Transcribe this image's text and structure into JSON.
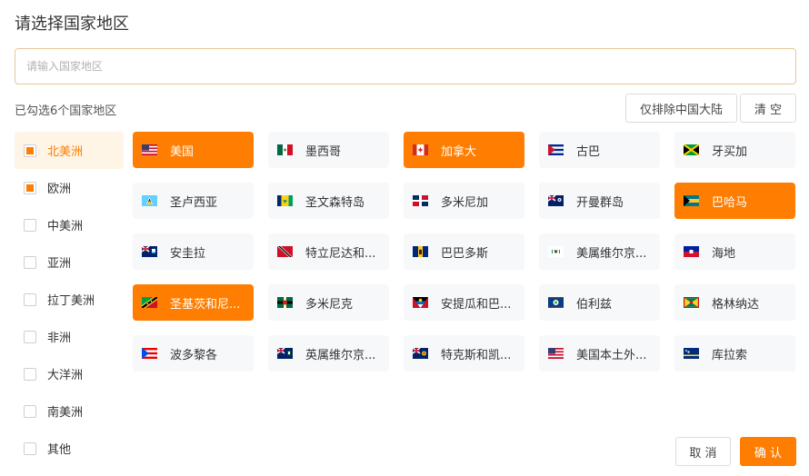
{
  "dialog": {
    "title": "请选择国家地区",
    "search_placeholder": "请输入国家地区",
    "selected_count_text": "已勾选6个国家地区",
    "exclude_button_label": "仅排除中国大陆",
    "clear_button_label": "清 空",
    "cancel_button_label": "取 消",
    "confirm_button_label": "确 认"
  },
  "colors": {
    "accent": "#ff7d00",
    "tile_bg": "#f7f8fa",
    "active_region_bg": "#fff5e6"
  },
  "regions": [
    {
      "label": "北美洲",
      "state": "partial",
      "active": true
    },
    {
      "label": "欧洲",
      "state": "partial",
      "active": false
    },
    {
      "label": "中美洲",
      "state": "unchecked",
      "active": false
    },
    {
      "label": "亚洲",
      "state": "unchecked",
      "active": false
    },
    {
      "label": "拉丁美洲",
      "state": "unchecked",
      "active": false
    },
    {
      "label": "非洲",
      "state": "unchecked",
      "active": false
    },
    {
      "label": "大洋洲",
      "state": "unchecked",
      "active": false
    },
    {
      "label": "南美洲",
      "state": "unchecked",
      "active": false
    },
    {
      "label": "其他",
      "state": "unchecked",
      "active": false
    }
  ],
  "countries": [
    {
      "label": "美国",
      "selected": true,
      "flag": "us-flag"
    },
    {
      "label": "墨西哥",
      "selected": false,
      "flag": "mexico-flag"
    },
    {
      "label": "加拿大",
      "selected": true,
      "flag": "canada-flag"
    },
    {
      "label": "古巴",
      "selected": false,
      "flag": "cuba-flag"
    },
    {
      "label": "牙买加",
      "selected": false,
      "flag": "jamaica-flag"
    },
    {
      "label": "圣卢西亚",
      "selected": false,
      "flag": "saint-lucia-flag"
    },
    {
      "label": "圣文森特岛",
      "selected": false,
      "flag": "saint-vincent-flag"
    },
    {
      "label": "多米尼加",
      "selected": false,
      "flag": "dominican-republic-flag"
    },
    {
      "label": "开曼群岛",
      "selected": false,
      "flag": "cayman-islands-flag"
    },
    {
      "label": "巴哈马",
      "selected": true,
      "flag": "bahamas-flag"
    },
    {
      "label": "安圭拉",
      "selected": false,
      "flag": "anguilla-flag"
    },
    {
      "label": "特立尼达和...",
      "selected": false,
      "flag": "trinidad-tobago-flag"
    },
    {
      "label": "巴巴多斯",
      "selected": false,
      "flag": "barbados-flag"
    },
    {
      "label": "美属维尔京...",
      "selected": false,
      "flag": "us-virgin-islands-flag"
    },
    {
      "label": "海地",
      "selected": false,
      "flag": "haiti-flag"
    },
    {
      "label": "圣基茨和尼...",
      "selected": true,
      "flag": "saint-kitts-nevis-flag"
    },
    {
      "label": "多米尼克",
      "selected": false,
      "flag": "dominica-flag"
    },
    {
      "label": "安提瓜和巴...",
      "selected": false,
      "flag": "antigua-barbuda-flag"
    },
    {
      "label": "伯利兹",
      "selected": false,
      "flag": "belize-flag"
    },
    {
      "label": "格林纳达",
      "selected": false,
      "flag": "grenada-flag"
    },
    {
      "label": "波多黎各",
      "selected": false,
      "flag": "puerto-rico-flag"
    },
    {
      "label": "英属维尔京...",
      "selected": false,
      "flag": "british-virgin-islands-flag"
    },
    {
      "label": "特克斯和凯...",
      "selected": false,
      "flag": "turks-caicos-flag"
    },
    {
      "label": "美国本土外...",
      "selected": false,
      "flag": "us-minor-islands-flag"
    },
    {
      "label": "库拉索",
      "selected": false,
      "flag": "curacao-flag"
    }
  ]
}
